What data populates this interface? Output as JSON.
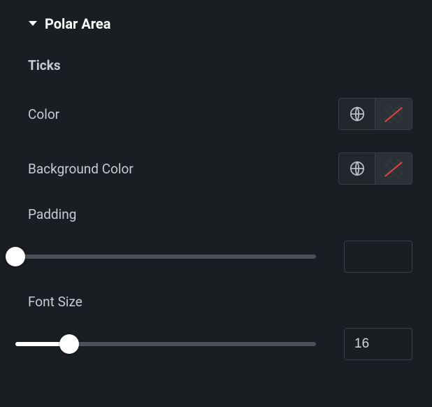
{
  "section": {
    "title": "Polar Area",
    "subsection": "Ticks"
  },
  "controls": {
    "color": {
      "label": "Color"
    },
    "background_color": {
      "label": "Background Color"
    },
    "padding": {
      "label": "Padding",
      "value": "",
      "slider_pct": 0
    },
    "font_size": {
      "label": "Font Size",
      "value": "16",
      "slider_pct": 18
    }
  }
}
